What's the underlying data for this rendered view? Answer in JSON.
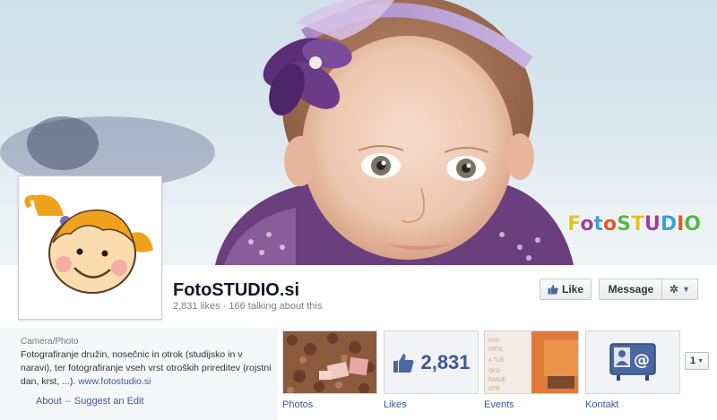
{
  "cover": {
    "logo_text": "FotoSTUDIO"
  },
  "page": {
    "name": "FotoSTUDIO.si",
    "stats": "2,831 likes · 166 talking about this"
  },
  "actions": {
    "like_label": "Like",
    "message_label": "Message",
    "gear_icon": "gear-icon"
  },
  "about": {
    "category": "Camera/Photo",
    "description": "Fotografiranje družin, nosečnic in otrok (studijsko in v naravi), ter fotografiranje vseh vrst otroških prireditev (rojstni dan, krst, ...).",
    "link": "www.fotostudio.si",
    "about_label": "About",
    "suggest_label": "Suggest an Edit"
  },
  "apps": {
    "photos_label": "Photos",
    "likes_label": "Likes",
    "likes_count": "2,831",
    "events_label": "Events",
    "kontakt_label": "Kontakt",
    "more_count": "1"
  },
  "colors": {
    "link": "#3b5998",
    "purple_accent": "#7a4b9a"
  }
}
